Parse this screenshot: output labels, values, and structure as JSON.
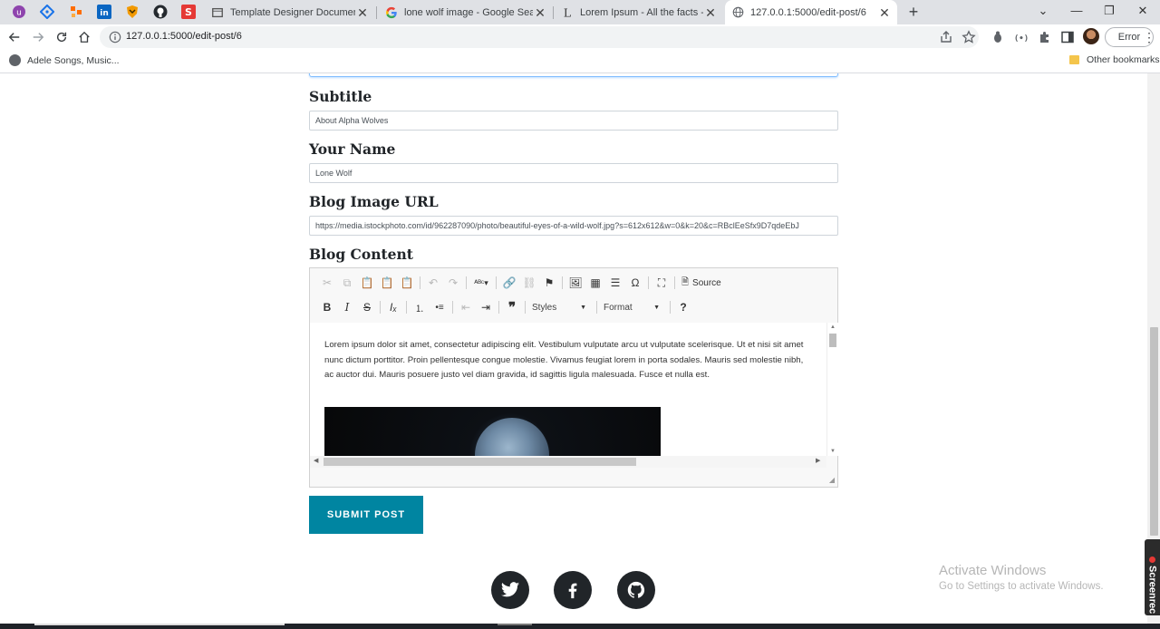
{
  "browser": {
    "tabs": [
      {
        "title": "Template Designer Documentatio",
        "active": false
      },
      {
        "title": "lone wolf image - Google Search",
        "active": false
      },
      {
        "title": "Lorem Ipsum - All the facts - Lips",
        "active": false
      },
      {
        "title": "127.0.0.1:5000/edit-post/6",
        "active": true
      }
    ],
    "url": "127.0.0.1:5000/edit-post/6",
    "profile_button": "Error",
    "bookmarks": {
      "left": "Adele Songs, Music...",
      "right": "Other bookmarks"
    }
  },
  "form": {
    "subtitle_label": "Subtitle",
    "subtitle_value": "About Alpha Wolves",
    "name_label": "Your Name",
    "name_value": "Lone Wolf",
    "image_label": "Blog Image URL",
    "image_value": "https://media.istockphoto.com/id/962287090/photo/beautiful-eyes-of-a-wild-wolf.jpg?s=612x612&w=0&k=20&c=RBclEeSfx9D7qdeEbJ",
    "content_label": "Blog Content",
    "editor": {
      "source_label": "Source",
      "styles_label": "Styles",
      "format_label": "Format",
      "help_label": "?",
      "body_text": "Lorem ipsum dolor sit amet, consectetur adipiscing elit. Vestibulum vulputate arcu ut vulputate scelerisque. Ut et nisi sit amet nunc dictum porttitor. Proin pellentesque congue molestie. Vivamus feugiat lorem in porta sodales. Mauris sed molestie nibh, ac auctor dui. Mauris posuere justo vel diam gravida, id sagittis ligula malesuada. Fusce et nulla est."
    },
    "submit_label": "SUBMIT POST"
  },
  "footer": {
    "social": [
      "twitter-icon",
      "facebook-icon",
      "github-icon"
    ]
  },
  "overlay": {
    "watermark_title": "Activate Windows",
    "watermark_sub": "Go to Settings to activate Windows.",
    "recorder": "Screenrec"
  },
  "colors": {
    "accent": "#0085a1",
    "focus_border": "#80bdff"
  }
}
